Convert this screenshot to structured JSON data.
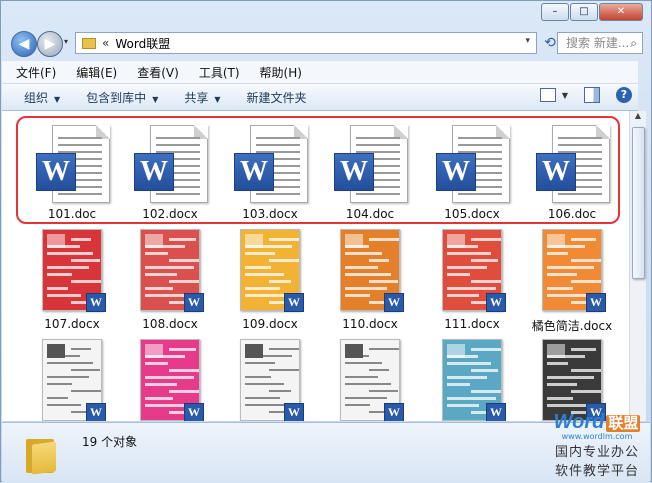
{
  "window": {
    "caption_buttons": [
      "–",
      "□",
      "✕"
    ]
  },
  "nav": {
    "back_glyph": "◀",
    "fwd_glyph": "▶",
    "dropdown_glyph": "▾",
    "address_chevron": "«",
    "address_text": "Word联盟",
    "address_dropdown": "▾",
    "refresh_glyph": "⟲",
    "search_placeholder": "搜索 新建...",
    "search_icon": "⌕"
  },
  "menu": [
    "文件(F)",
    "编辑(E)",
    "查看(V)",
    "工具(T)",
    "帮助(H)"
  ],
  "toolbar": {
    "items": [
      {
        "label": "组织",
        "dropdown": "▼"
      },
      {
        "label": "包含到库中",
        "dropdown": "▼"
      },
      {
        "label": "共享",
        "dropdown": "▼"
      },
      {
        "label": "新建文件夹",
        "dropdown": ""
      }
    ],
    "view_dropdown": "▼",
    "help_glyph": "?"
  },
  "files_row1": [
    {
      "name": "101.doc"
    },
    {
      "name": "102.docx"
    },
    {
      "name": "103.docx"
    },
    {
      "name": "104.doc"
    },
    {
      "name": "105.docx"
    },
    {
      "name": "106.doc"
    }
  ],
  "files_row2": [
    {
      "name": "107.docx",
      "color": "#d8353b"
    },
    {
      "name": "108.docx",
      "color": "#d9504f"
    },
    {
      "name": "109.docx",
      "color": "#f2b233"
    },
    {
      "name": "110.docx",
      "color": "#e5802a"
    },
    {
      "name": "111.docx",
      "color": "#e04d3c"
    },
    {
      "name": "橘色简洁.docx",
      "color": "#f08a34"
    }
  ],
  "files_row3": [
    {
      "color": "#f4f4f4"
    },
    {
      "color": "#e63a8b"
    },
    {
      "color": "#f4f4f4"
    },
    {
      "color": "#f4f4f4"
    },
    {
      "color": "#5aa8c4"
    },
    {
      "color": "#3a3a3a"
    }
  ],
  "word_glyph": "W",
  "status": {
    "count": "19 个对象"
  },
  "watermark": {
    "brand": "Word",
    "brand_cn": "联盟",
    "url": "www.wordlm.com",
    "line1": "国内专业办公",
    "line2": "软件教学平台"
  }
}
